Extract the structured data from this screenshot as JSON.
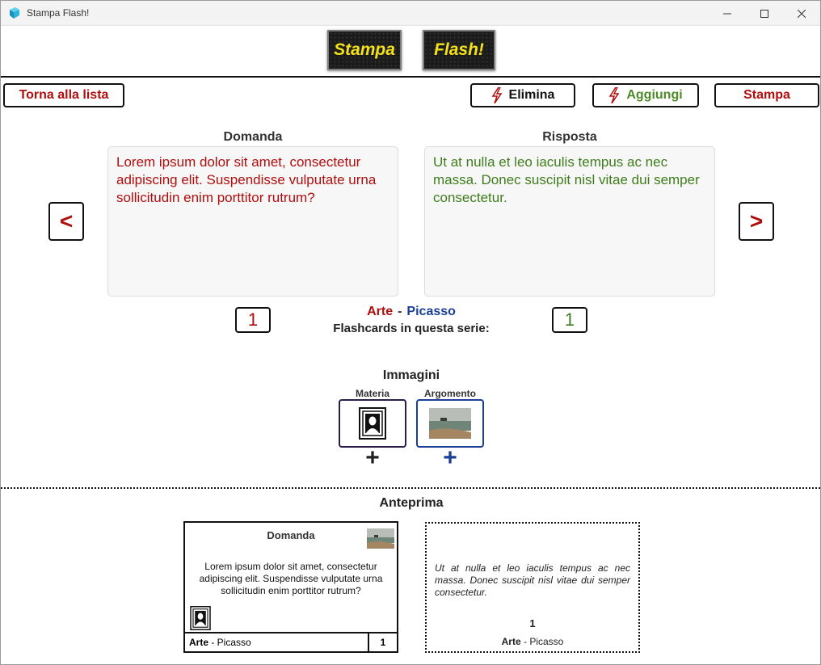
{
  "window": {
    "title": "Stampa Flash!"
  },
  "logo": {
    "word1": "Stampa",
    "word2": "Flash!"
  },
  "toolbar": {
    "back_label": "Torna alla lista",
    "delete_label": "Elimina",
    "add_label": "Aggiungi",
    "print_label": "Stampa"
  },
  "editor": {
    "question_heading": "Domanda",
    "answer_heading": "Risposta",
    "question_text": "Lorem ipsum dolor sit amet, consectetur adipiscing elit. Suspendisse vulputate urna sollicitudin enim porttitor rutrum?",
    "answer_text": "Ut at nulla et leo iaculis tempus ac nec massa. Donec suscipit nisl vitae dui semper consectetur.",
    "prev_label": "<",
    "next_label": ">",
    "question_counter": "1",
    "answer_counter": "1"
  },
  "series": {
    "subject": "Arte",
    "separator": "-",
    "topic": "Picasso",
    "count_label": "Flashcards in questa serie:"
  },
  "images": {
    "title": "Immagini",
    "subject_label": "Materia",
    "topic_label": "Argomento",
    "plus": "+"
  },
  "preview": {
    "title": "Anteprima",
    "front_heading": "Domanda",
    "front_text": "Lorem ipsum dolor sit amet, consectetur adipiscing elit. Suspendisse vulputate urna sollicitudin enim porttitor rutrum?",
    "front_subject": "Arte",
    "front_topic": " - Picasso",
    "front_number": "1",
    "back_text": "Ut at nulla et leo iaculis tempus ac nec massa. Donec suscipit nisl vitae dui semper consectetur.",
    "back_number": "1",
    "back_subject": "Arte",
    "back_topic": " - Picasso"
  },
  "colors": {
    "question": "#b00d0d",
    "answer": "#3f7d1c",
    "topic": "#1a3f96",
    "logo_text": "#f3e21a"
  }
}
